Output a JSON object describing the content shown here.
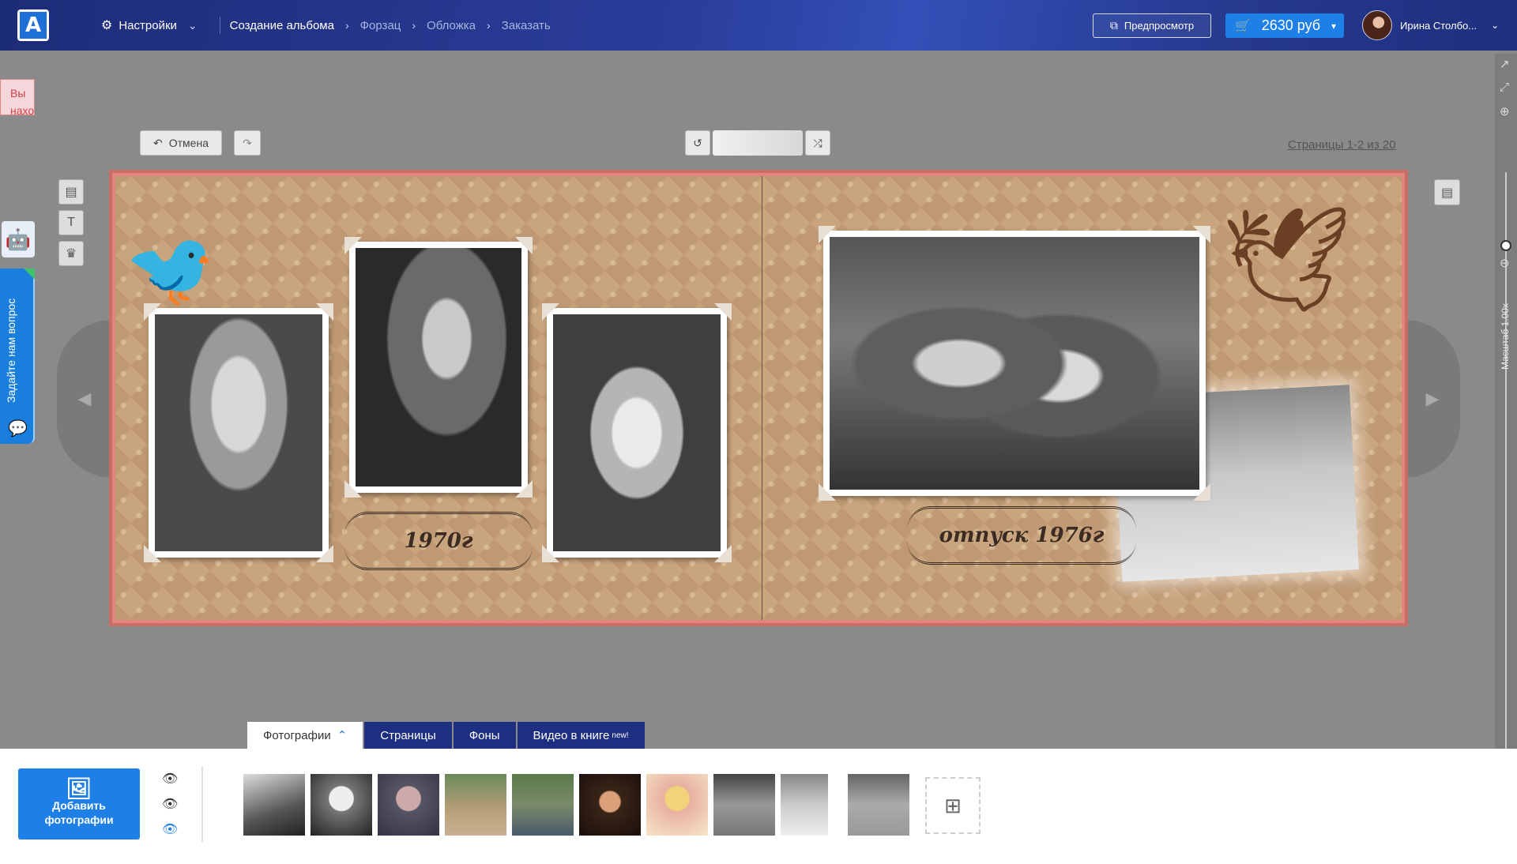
{
  "header": {
    "settings_label": "Настройки",
    "breadcrumbs": [
      "Создание альбома",
      "Форзац",
      "Обложка",
      "Заказать"
    ],
    "preview_label": "Предпросмотр",
    "price_label": "2630 руб",
    "user_name": "Ирина Столбо..."
  },
  "side": {
    "vy_badge": "Вы наход",
    "ask_label": "Задайте нам вопрос"
  },
  "toolbar": {
    "undo_label": "Отмена",
    "pages_label": "Страницы 1-2 из 20"
  },
  "zoom": {
    "label": "Масштаб 1.00x"
  },
  "album": {
    "caption_left": "1970г",
    "caption_right": "отпуск 1976г"
  },
  "bottom": {
    "tabs": [
      "Фотографии",
      "Страницы",
      "Фоны",
      "Видео в книге"
    ],
    "tab_badge": "new!",
    "add_photos_label_1": "Добавить",
    "add_photos_label_2": "фотографии",
    "thumbnails": 10
  },
  "colors": {
    "topbar": "#1f2f7e",
    "accent_blue": "#1e7fe6",
    "album_border": "#e1857d",
    "album_bg": "#c9a57e"
  },
  "icons": [
    "settings-icon",
    "chevron-right-icon",
    "preview-icon",
    "cart-icon",
    "undo-icon",
    "redo-icon",
    "rotate-icon",
    "shuffle-icon",
    "layout-icon",
    "text-icon",
    "crown-icon",
    "eye-icon",
    "add-photo-icon",
    "bird-icon"
  ]
}
